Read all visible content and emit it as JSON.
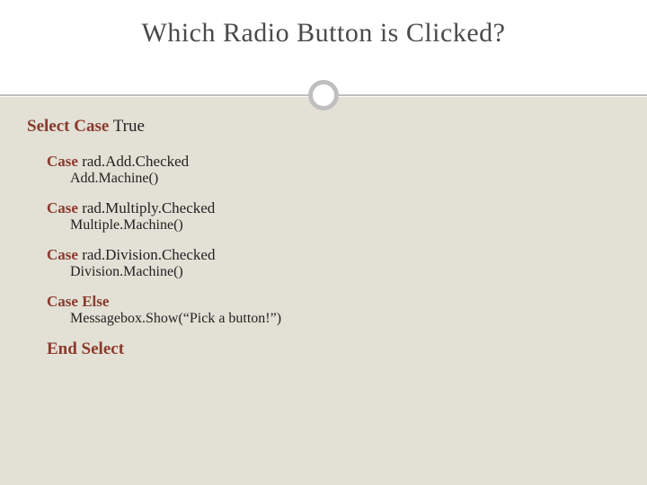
{
  "title": "Which Radio Button is Clicked?",
  "code": {
    "select_kw": "Select Case",
    "select_expr": "True",
    "cases": [
      {
        "kw": "Case",
        "expr": "rad.Add.Checked",
        "body": "Add.Machine()"
      },
      {
        "kw": "Case",
        "expr": "rad.Multiply.Checked",
        "body": "Multiple.Machine()"
      },
      {
        "kw": "Case",
        "expr": "rad.Division.Checked",
        "body": "Division.Machine()"
      },
      {
        "kw": "Case Else",
        "expr": "",
        "body": "Messagebox.Show(“Pick a button!”)"
      }
    ],
    "end": "End Select"
  }
}
